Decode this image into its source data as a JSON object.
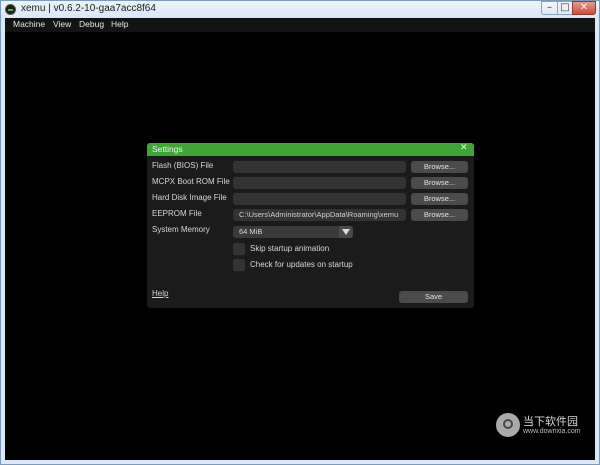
{
  "window": {
    "title": "xemu | v0.6.2-10-gaa7acc8f64",
    "controls": {
      "minimize": "–",
      "maximize": "□",
      "close": "✕"
    }
  },
  "menubar": {
    "items": [
      "Machine",
      "View",
      "Debug",
      "Help"
    ]
  },
  "settings": {
    "title": "Settings",
    "close_glyph": "✕",
    "rows": [
      {
        "label": "Flash (BIOS) File",
        "value": "",
        "button": "Browse..."
      },
      {
        "label": "MCPX Boot ROM File",
        "value": "",
        "button": "Browse..."
      },
      {
        "label": "Hard Disk Image File",
        "value": "",
        "button": "Browse..."
      },
      {
        "label": "EEPROM File",
        "value": "C:\\Users\\Administrator\\AppData\\Roaming\\xemu",
        "button": "Browse..."
      }
    ],
    "system_memory": {
      "label": "System Memory",
      "value": "64 MiB"
    },
    "checkboxes": [
      {
        "label": "Skip startup animation",
        "checked": false
      },
      {
        "label": "Check for updates on startup",
        "checked": false
      }
    ],
    "help_label": "Help",
    "save_label": "Save"
  },
  "watermark": {
    "text": "当下软件园",
    "url": "www.downxia.com"
  },
  "colors": {
    "accent": "#3fa535",
    "dialog_bg": "#1b1b1b",
    "field_bg": "#333333",
    "button_bg": "#4b4b4b"
  }
}
